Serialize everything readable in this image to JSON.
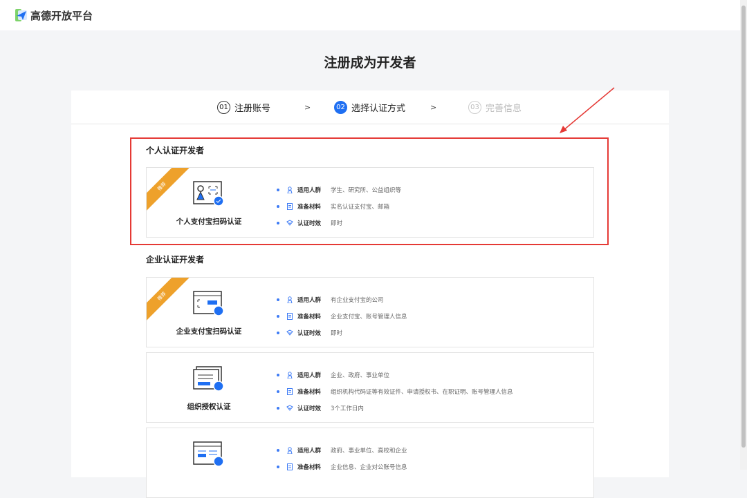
{
  "header": {
    "brand": "高德开放平台"
  },
  "page_title": "注册成为开发者",
  "steps": [
    {
      "num": "01",
      "label": "注册账号",
      "state": "done"
    },
    {
      "num": "02",
      "label": "选择认证方式",
      "state": "active"
    },
    {
      "num": "03",
      "label": "完善信息",
      "state": "todo"
    }
  ],
  "step_separator": ">",
  "sections": [
    {
      "title": "个人认证开发者",
      "cards": [
        {
          "title": "个人支付宝扫码认证",
          "badge": "推荐",
          "icon": "personal-scan-icon",
          "rows": [
            {
              "label": "适用人群",
              "value": "学生、研究所、公益组织等"
            },
            {
              "label": "准备材料",
              "value": "实名认证支付宝、邮箱"
            },
            {
              "label": "认证时效",
              "value": "即时"
            }
          ]
        }
      ]
    },
    {
      "title": "企业认证开发者",
      "cards": [
        {
          "title": "企业支付宝扫码认证",
          "badge": "推荐",
          "icon": "enterprise-scan-icon",
          "rows": [
            {
              "label": "适用人群",
              "value": "有企业支付宝的公司"
            },
            {
              "label": "准备材料",
              "value": "企业支付宝、账号管理人信息"
            },
            {
              "label": "认证时效",
              "value": "即时"
            }
          ]
        },
        {
          "title": "组织授权认证",
          "badge": null,
          "icon": "organization-auth-icon",
          "rows": [
            {
              "label": "适用人群",
              "value": "企业、政府、事业单位"
            },
            {
              "label": "准备材料",
              "value": "组织机构代码证等有效证件、申请授权书、在职证明、账号管理人信息"
            },
            {
              "label": "认证时效",
              "value": "3个工作日内"
            }
          ]
        },
        {
          "title": "",
          "badge": null,
          "icon": "enterprise-account-icon",
          "rows": [
            {
              "label": "适用人群",
              "value": "政府、事业单位、高校和企业"
            },
            {
              "label": "准备材料",
              "value": "企业信息、企业对公账号信息"
            }
          ]
        }
      ]
    }
  ],
  "colors": {
    "accent": "#1f6ff2",
    "badge": "#eea12b",
    "highlight": "#e53935"
  }
}
